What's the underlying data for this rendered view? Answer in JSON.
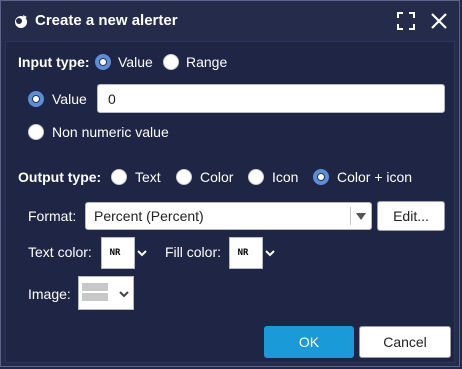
{
  "dialog": {
    "title": "Create a new alerter",
    "icons": {
      "title": "alerter-icon",
      "maximize": "maximize-icon",
      "close": "close-icon"
    }
  },
  "input_type": {
    "label": "Input type:",
    "options": [
      {
        "label": "Value",
        "selected": true
      },
      {
        "label": "Range",
        "selected": false
      }
    ],
    "value_option": {
      "label": "Value",
      "selected": true
    },
    "value_field": {
      "value": "0",
      "placeholder": ""
    },
    "non_numeric_option": {
      "label": "Non numeric value",
      "selected": false
    }
  },
  "output_type": {
    "label": "Output type:",
    "options": [
      {
        "label": "Text",
        "selected": false
      },
      {
        "label": "Color",
        "selected": false
      },
      {
        "label": "Icon",
        "selected": false
      },
      {
        "label": "Color + icon",
        "selected": true
      }
    ]
  },
  "format": {
    "label": "Format:",
    "selected": "Percent (Percent)",
    "edit_label": "Edit..."
  },
  "colors": {
    "text_color_label": "Text color:",
    "text_color_value": "NR",
    "fill_color_label": "Fill color:",
    "fill_color_value": "NR"
  },
  "image": {
    "label": "Image:"
  },
  "footer": {
    "ok_label": "OK",
    "cancel_label": "Cancel"
  },
  "theme": {
    "background": "#232946",
    "accent": "#1a9bd7",
    "radio_checked": "#5b8dd8"
  }
}
